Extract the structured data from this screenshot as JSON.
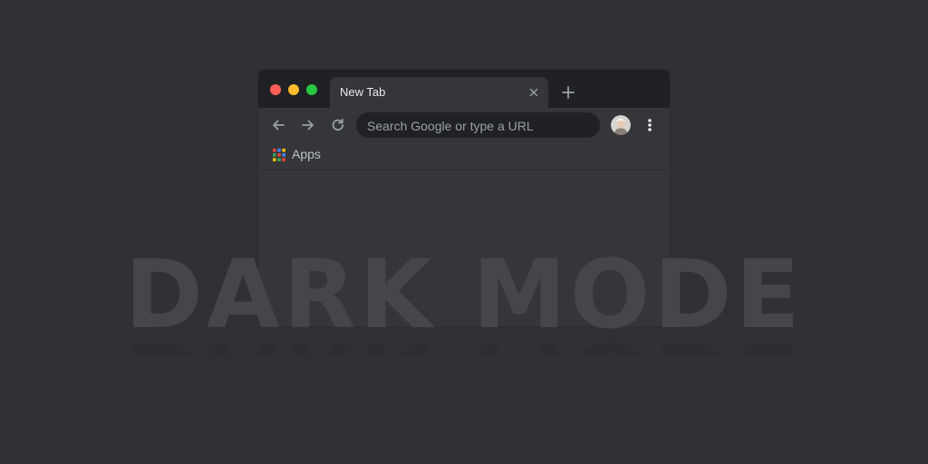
{
  "browser": {
    "tab": {
      "title": "New Tab"
    },
    "omnibox": {
      "placeholder": "Search Google or type a URL"
    },
    "bookmarks": {
      "apps_label": "Apps"
    }
  },
  "hero": {
    "text": "DARK MODE"
  },
  "icons": {
    "traffic_red": "close-window-dot",
    "traffic_yellow": "minimize-window-dot",
    "traffic_green": "maximize-window-dot",
    "tab_close": "close-icon",
    "new_tab": "plus-icon",
    "back": "arrow-left-icon",
    "forward": "arrow-right-icon",
    "reload": "reload-icon",
    "avatar": "profile-avatar",
    "menu": "kebab-menu-icon",
    "apps": "apps-grid-icon"
  },
  "colors": {
    "page_bg": "#303134",
    "toolbar_bg": "#35363a",
    "tabstrip_bg": "#202124",
    "omnibox_bg": "#202124",
    "text_primary": "#e8eaed",
    "text_secondary": "#9aa0a6",
    "hero_text": "#44464b",
    "traffic_red": "#ff5f57",
    "traffic_yellow": "#febc2e",
    "traffic_green": "#28c840"
  }
}
